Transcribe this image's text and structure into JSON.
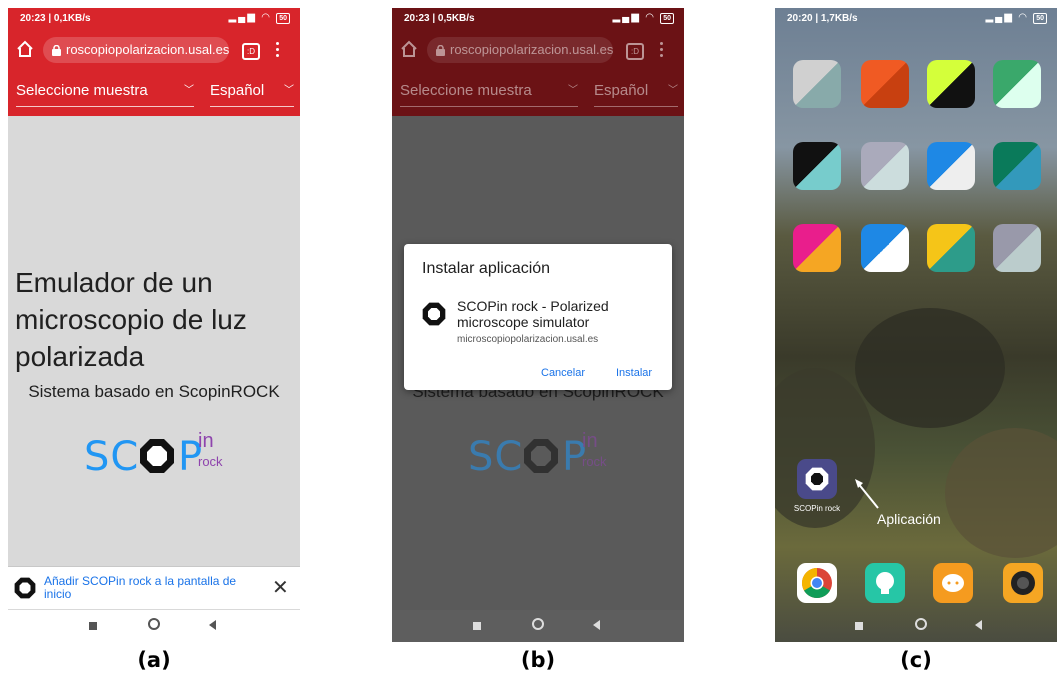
{
  "panel_a": {
    "status_time": "20:23 | 0,1KB/s",
    "battery": "50",
    "url": "roscopiopolarizacion.usal.es",
    "tab_count": ":D",
    "sample_select": "Seleccione muestra",
    "language_select": "Español",
    "heading": "Emulador de un microscopio de luz polarizada",
    "subline": "Sistema basado en ScopinROCK",
    "logo": {
      "sc": "SC",
      "p": "P",
      "in": "in",
      "rock": "rock"
    },
    "banner_text": "Añadir SCOPin rock a la pantalla de inicio",
    "banner_close": "✕"
  },
  "panel_b": {
    "status_time": "20:23 | 0,5KB/s",
    "battery": "50",
    "url": "roscopiopolarizacion.usal.es",
    "tab_count": ":D",
    "sample_select": "Seleccione muestra",
    "language_select": "Español",
    "subline": "Sistema basado en ScopinROCK",
    "logo": {
      "sc": "SC",
      "p": "P",
      "in": "in",
      "rock": "rock"
    },
    "dialog": {
      "title": "Instalar aplicación",
      "app_name": "SCOPin rock - Polarized microscope simulator",
      "app_url": "microscopiopolarizacion.usal.es",
      "cancel": "Cancelar",
      "install": "Instalar"
    }
  },
  "panel_c": {
    "status_time": "20:20 | 1,7KB/s",
    "battery": "50",
    "app_label": "SCOPin rock",
    "annotation": "Aplicación"
  },
  "captions": [
    "(a)",
    "(b)",
    "(c)"
  ],
  "colors": {
    "chrome": "#d8252b",
    "link": "#1a73e8",
    "logo_blue": "#2196f3",
    "logo_purple": "#8e44ad"
  }
}
